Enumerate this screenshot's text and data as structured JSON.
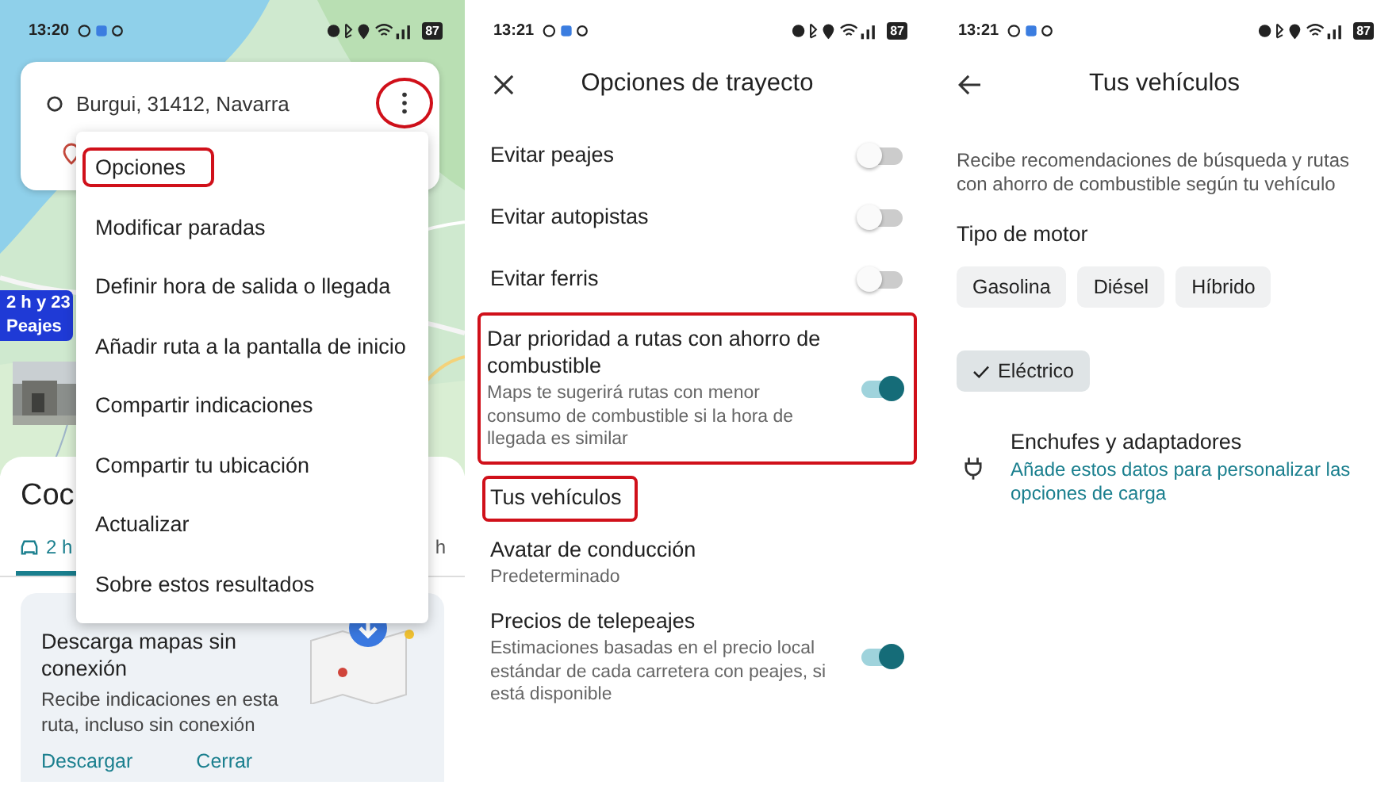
{
  "map_screen": {
    "status_bar": {
      "time": "13:20",
      "battery": "87"
    },
    "search": {
      "origin": "Burgui, 31412, Navarra",
      "menu_highlighted": true
    },
    "route_label": {
      "duration": "2 h y 23",
      "note": "Peajes"
    },
    "menu": [
      {
        "label": "Opciones",
        "highlighted": true
      },
      {
        "label": "Modificar paradas",
        "highlighted": false
      },
      {
        "label": "Definir hora de salida o llegada",
        "highlighted": false
      },
      {
        "label": "Añadir ruta a la pantalla de inicio",
        "highlighted": false
      },
      {
        "label": "Compartir indicaciones",
        "highlighted": false
      },
      {
        "label": "Compartir tu ubicación",
        "highlighted": false
      },
      {
        "label": "Actualizar",
        "highlighted": false
      },
      {
        "label": "Sobre estos resultados",
        "highlighted": false
      }
    ],
    "sheet": {
      "title": "Coc",
      "tabs": [
        {
          "label": "2 h",
          "selected": true
        },
        {
          "label": "h",
          "selected": false
        }
      ],
      "card": {
        "title": "Descarga mapas sin conexión",
        "text": "Recibe indicaciones en esta ruta, incluso sin conexión",
        "actions": [
          "Descargar",
          "Cerrar"
        ]
      }
    }
  },
  "route_options": {
    "status_bar": {
      "time": "13:21",
      "battery": "87"
    },
    "title": "Opciones de trayecto",
    "rows": [
      {
        "kind": "toggle",
        "title": "Evitar peajes",
        "on": false,
        "highlighted": false
      },
      {
        "kind": "toggle",
        "title": "Evitar autopistas",
        "on": false,
        "highlighted": false
      },
      {
        "kind": "toggle",
        "title": "Evitar ferris",
        "on": false,
        "highlighted": false
      },
      {
        "kind": "toggle",
        "title": "Dar prioridad a rutas con ahorro de combustible",
        "subtitle": "Maps te sugerirá rutas con menor consumo de combustible si la hora de llegada es similar",
        "on": true,
        "highlighted": true
      },
      {
        "kind": "link",
        "title": "Tus vehículos",
        "highlighted": true
      },
      {
        "kind": "link",
        "title": "Avatar de conducción",
        "subtitle": "Predeterminado",
        "highlighted": false
      },
      {
        "kind": "toggle",
        "title": "Precios de telepeajes",
        "subtitle": "Estimaciones basadas en el precio local estándar de cada carretera con peajes, si está disponible",
        "on": true,
        "highlighted": false
      }
    ]
  },
  "vehicles": {
    "status_bar": {
      "time": "13:21",
      "battery": "87"
    },
    "title": "Tus vehículos",
    "description": "Recibe recomendaciones de búsqueda y rutas con ahorro de combustible según tu vehículo",
    "engine_heading": "Tipo de motor",
    "engines": [
      {
        "label": "Gasolina",
        "selected": false
      },
      {
        "label": "Diésel",
        "selected": false
      },
      {
        "label": "Híbrido",
        "selected": false
      },
      {
        "label": "Eléctrico",
        "selected": true
      }
    ],
    "plugs": {
      "title": "Enchufes y adaptadores",
      "link": "Añade estos datos para personalizar las opciones de carga"
    }
  }
}
